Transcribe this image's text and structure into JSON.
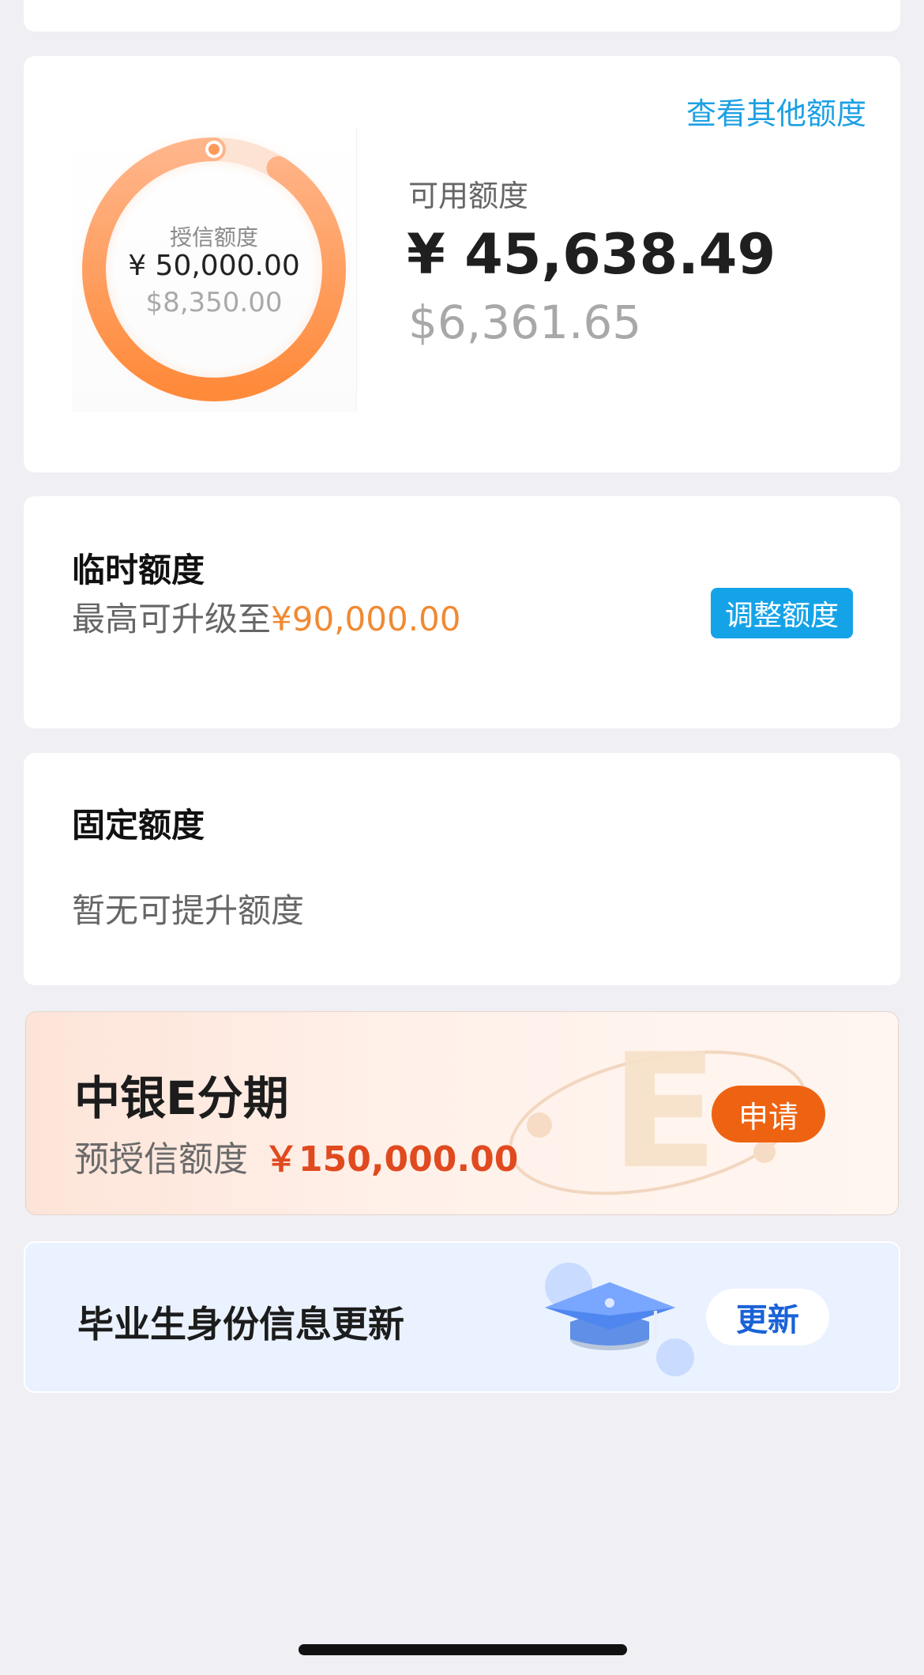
{
  "credit": {
    "other_link": "查看其他额度",
    "ring_title": "授信额度",
    "ring_cny": "¥ 50,000.00",
    "ring_usd": "$8,350.00",
    "ring_progress_fraction": 0.91,
    "available_label": "可用额度",
    "available_cny": "¥ 45,638.49",
    "available_usd": "$6,361.65"
  },
  "temporary": {
    "title": "临时额度",
    "sub_prefix": "最高可升级至",
    "sub_amount": "¥90,000.00",
    "button": "调整额度"
  },
  "fixed": {
    "title": "固定额度",
    "sub": "暂无可提升额度"
  },
  "e_installment": {
    "title": "中银E分期",
    "sub_label": "预授信额度",
    "amount": "￥150,000.00",
    "button": "申请"
  },
  "graduate": {
    "title": "毕业生身份信息更新",
    "button": "更新"
  },
  "colors": {
    "link_blue": "#1ca0e3",
    "accent_orange": "#f08a33",
    "apply_orange": "#ee6311",
    "amount_red": "#e04a1f",
    "update_blue": "#1a62d8"
  }
}
